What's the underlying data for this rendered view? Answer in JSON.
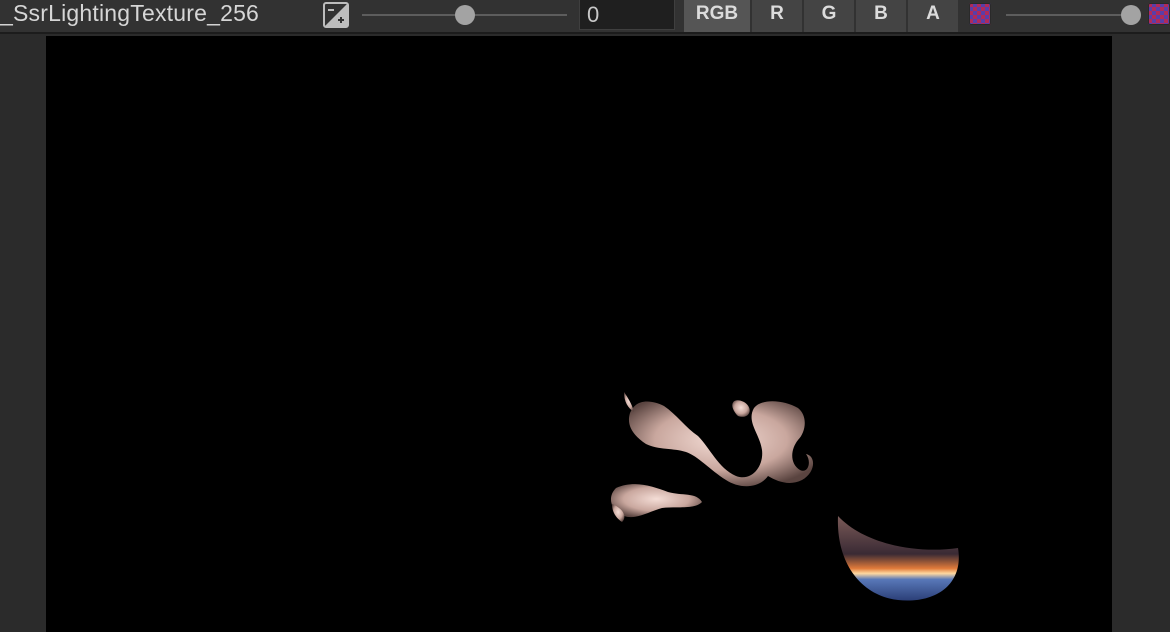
{
  "toolbar": {
    "texture_name": "_SsrLightingTexture_256",
    "mip_value": "0",
    "mip_level_fraction": 0.5,
    "alpha_level_fraction": 0.98,
    "channels": [
      {
        "label": "RGB",
        "active": true
      },
      {
        "label": "R",
        "active": false
      },
      {
        "label": "G",
        "active": false
      },
      {
        "label": "B",
        "active": false
      },
      {
        "label": "A",
        "active": false
      }
    ],
    "icons": {
      "exposure": "exposure-icon",
      "checker_small": "checkerboard-icon",
      "checker_large": "checkerboard-icon"
    }
  },
  "colors": {
    "toolbar_bg": "#323232",
    "viewport_bg": "#000000",
    "panel_bg": "#2b2b2b"
  }
}
